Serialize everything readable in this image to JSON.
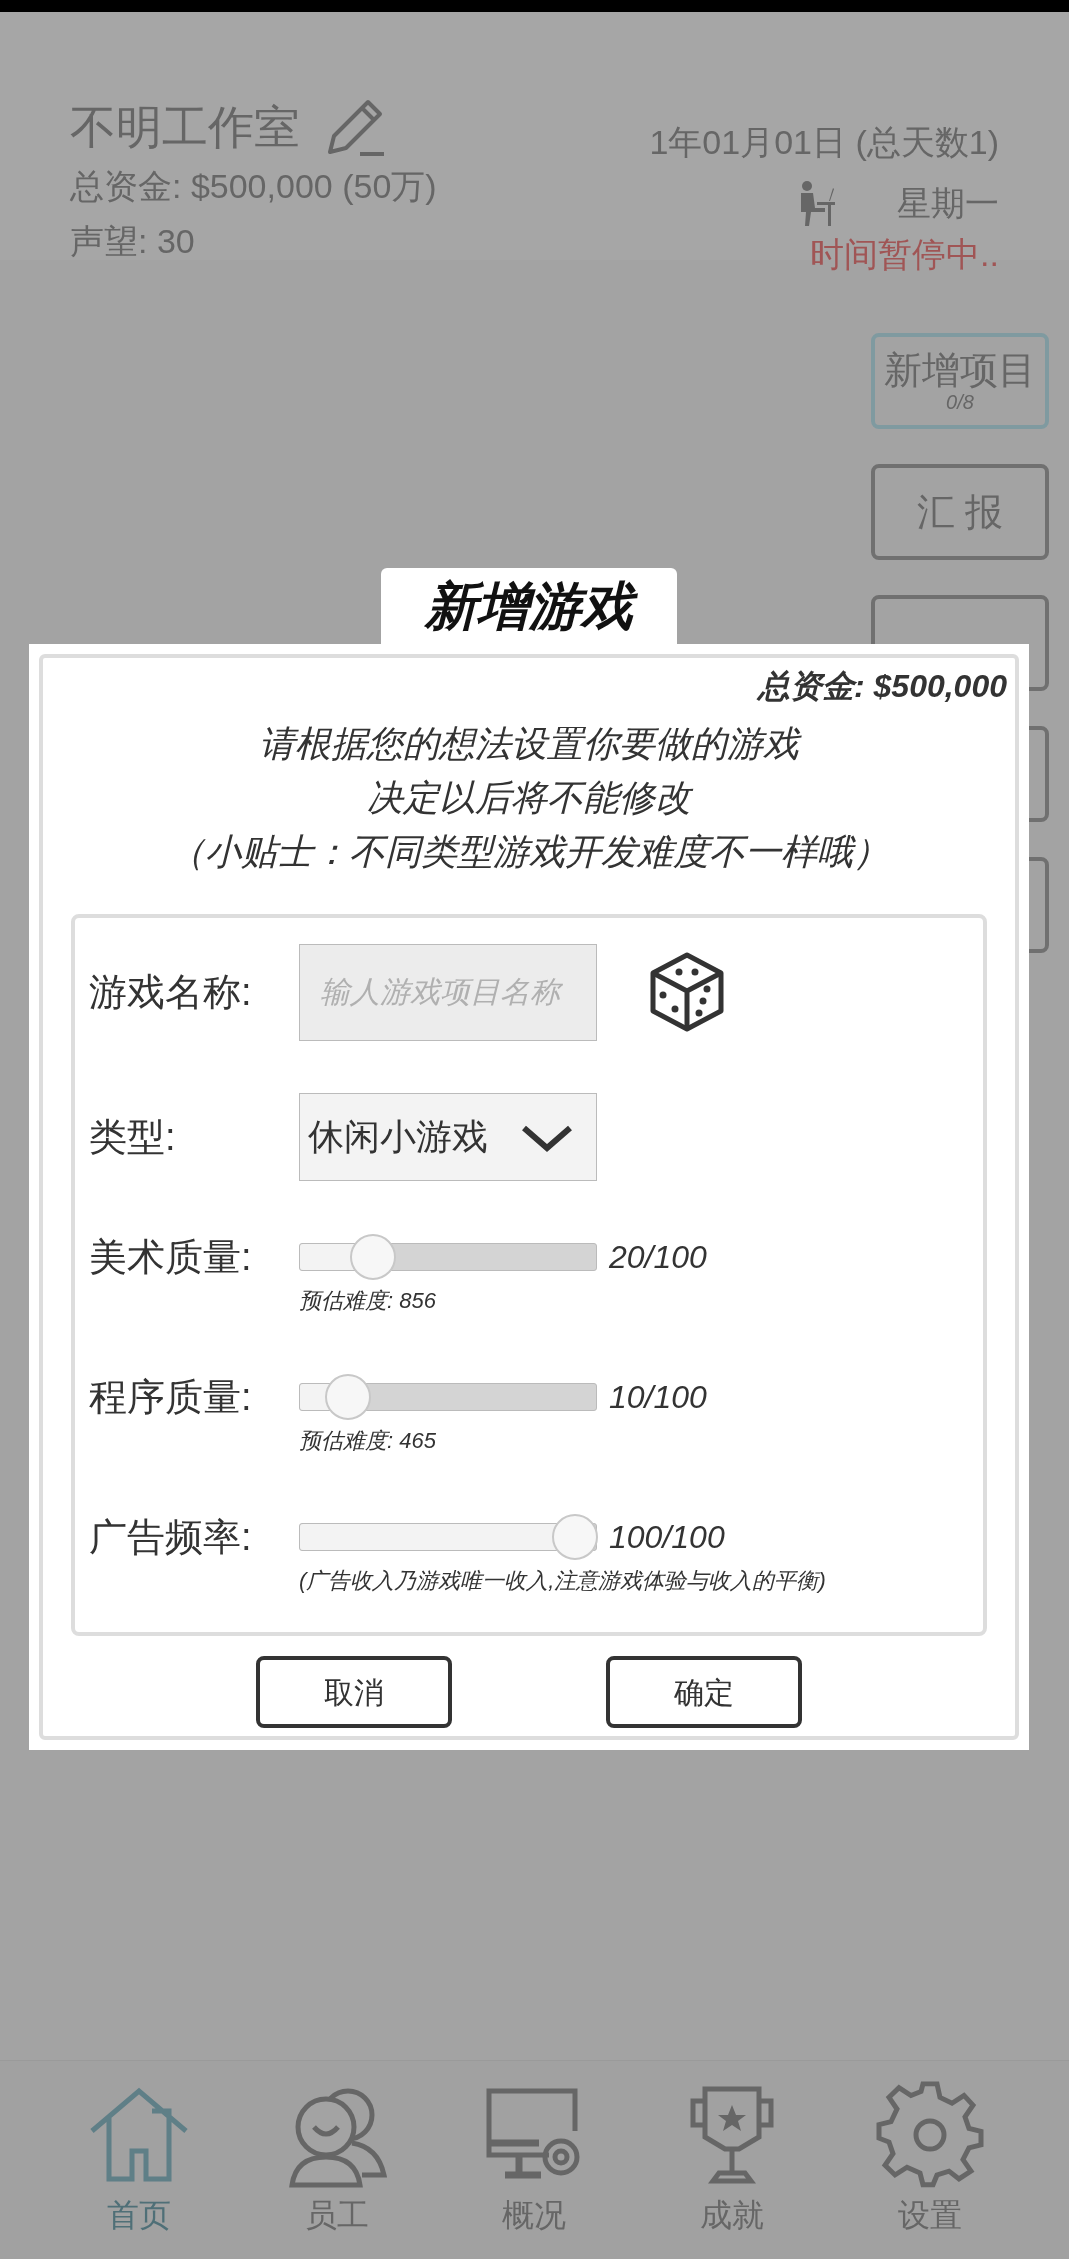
{
  "header": {
    "studio_name": "不明工作室",
    "funds": "总资金: $500,000 (50万)",
    "reputation": "声望: 30",
    "date": "1年01月01日 (总天数1)",
    "weekday": "星期一",
    "time_status": "时间暂停中.."
  },
  "side_buttons": [
    {
      "label": "新增项目",
      "sublabel": "0/8",
      "selected": true
    },
    {
      "label": "汇 报",
      "selected": false
    },
    {
      "selected": false
    },
    {
      "selected": false
    },
    {
      "selected": false
    }
  ],
  "dialog": {
    "title": "新增游戏",
    "funds": "总资金: $500,000",
    "intro_lines": [
      "请根据您的想法设置你要做的游戏",
      "决定以后将不能修改",
      "（小贴士：不同类型游戏开发难度不一样哦）"
    ],
    "fields": [
      {
        "kind": "text",
        "label": "游戏名称:",
        "placeholder": "输人游戏项目名称"
      },
      {
        "kind": "select",
        "label": "类型:",
        "value": "休闲小游戏"
      },
      {
        "kind": "slider",
        "label": "美术质量:",
        "level": 0.2,
        "reading": "20/100",
        "note": "预估难度: 856"
      },
      {
        "kind": "slider",
        "label": "程序质量:",
        "level": 0.1,
        "reading": "10/100",
        "note": "预估难度: 465"
      },
      {
        "kind": "slider",
        "label": "广告频率:",
        "level": 1,
        "reading": "100/100",
        "note": "(广告收入乃游戏唯一收入,注意游戏体验与收入的平衡)"
      }
    ],
    "buttons": [
      "取消",
      "确定"
    ]
  },
  "nav": [
    {
      "label": "首页",
      "selected": true
    },
    {
      "label": "员工",
      "selected": false
    },
    {
      "label": "概况",
      "selected": false
    },
    {
      "label": "成就",
      "selected": false
    },
    {
      "label": "设置",
      "selected": false
    }
  ]
}
